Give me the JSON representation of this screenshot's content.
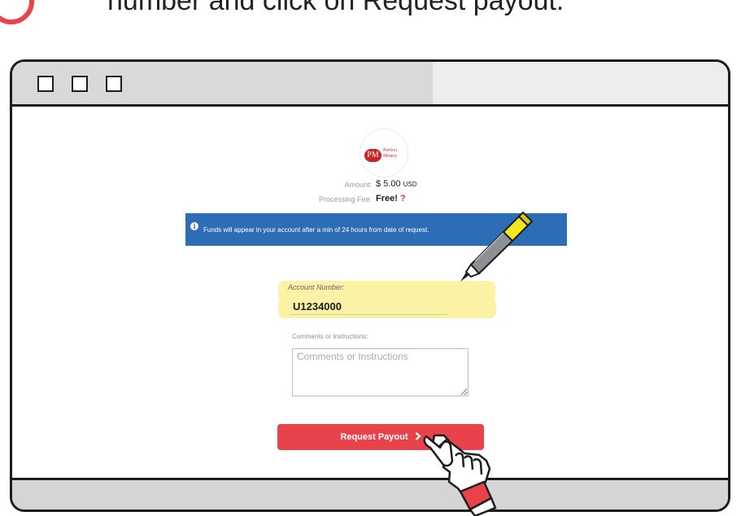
{
  "instruction": {
    "text": "number and click on Request payout."
  },
  "titlebar": {
    "buttons": [
      "square-button",
      "square-button",
      "square-button"
    ]
  },
  "logo": {
    "badge": "PM",
    "line1": "Perfect",
    "line2": "Money"
  },
  "summary": {
    "amount_label": "Amount:",
    "amount_value": "$ 5.00",
    "amount_currency": "USD",
    "fee_label": "Processing Fee:",
    "fee_value": "Free!",
    "fee_help": "?"
  },
  "info_banner": {
    "icon": "info-icon",
    "text": "Funds will appear in your account after a min of 24 hours from date of request."
  },
  "account": {
    "label": "Account Number:",
    "value": "U1234000"
  },
  "comments": {
    "label": "Comments or Instructions:",
    "placeholder": "Comments or Instructions"
  },
  "request_button": {
    "label": "Request Payout",
    "icon": "chevron-right-icon"
  },
  "colors": {
    "accent_red": "#e8434b",
    "info_blue": "#2d6db5",
    "highlight_yellow": "#fbf2a6",
    "titlebar_gray": "#d8d9db",
    "outline": "#1d1d1d"
  }
}
